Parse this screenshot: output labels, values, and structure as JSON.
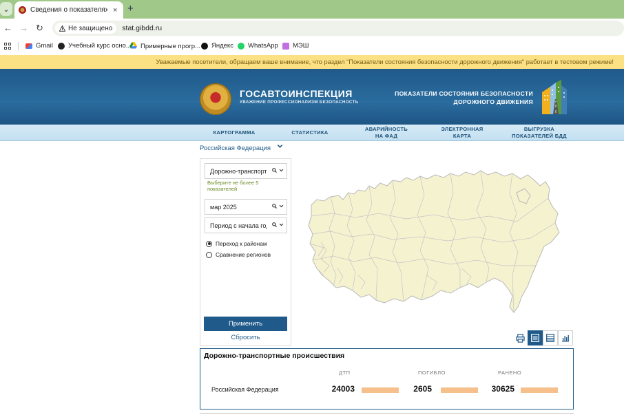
{
  "browser": {
    "tab_title": "Сведения о показателях состояния безопасности дорожного движения",
    "tab_close": "×",
    "new_tab": "+",
    "security_label": "Не защищено",
    "url": "stat.gibdd.ru",
    "nav": {
      "back": "←",
      "forward": "→",
      "reload": "↻"
    },
    "bookmarks": [
      {
        "label": "Gmail",
        "icon": "gmail-icon",
        "color": "#d93025"
      },
      {
        "label": "Учебный курс осно...",
        "icon": "globe-icon",
        "color": "#222222"
      },
      {
        "label": "Примерные прогр...",
        "icon": "google-drive-icon",
        "color": "#1e8e3e"
      },
      {
        "label": "Яндекс",
        "icon": "yandex-icon",
        "color": "#111111"
      },
      {
        "label": "WhatsApp",
        "icon": "whatsapp-icon",
        "color": "#25d366"
      },
      {
        "label": "МЭШ",
        "icon": "mesh-icon",
        "color": "#a040c0"
      }
    ]
  },
  "notice": "Уважаемые посетители, обращаем ваше внимание, что раздел \"Показатели состояния безопасности дорожного движения\" работает в тестовом режиме!",
  "header": {
    "brand_title": "ГОСАВТОИНСПЕКЦИЯ",
    "brand_subtitle": "УВАЖЕНИЕ ПРОФЕССИОНАЛИЗМ БЕЗОПАСНОСТЬ",
    "portal_title_line1": "ПОКАЗАТЕЛИ СОСТОЯНИЯ БЕЗОПАСНОСТИ",
    "portal_title_line2": "ДОРОЖНОГО ДВИЖЕНИЯ"
  },
  "menu": [
    {
      "line1": "КАРТОГРАММА",
      "line2": ""
    },
    {
      "line1": "СТАТИСТИКА",
      "line2": ""
    },
    {
      "line1": "АВАРИЙНОСТЬ",
      "line2": "НА ФАД"
    },
    {
      "line1": "ЭЛЕКТРОННАЯ",
      "line2": "КАРТА"
    },
    {
      "line1": "ВЫГРУЗКА",
      "line2": "ПОКАЗАТЕЛЕЙ БДД"
    }
  ],
  "filters": {
    "region": "Российская Федерация",
    "indicator": "Дорожно-транспортные происшествия",
    "indicator_hint": "Выберите не более 5 показателей",
    "period_month": "мар 2025",
    "period_type": "Период с начала года",
    "radio_districts": "Переход к районам",
    "radio_compare": "Сравнение регионов",
    "radio_selected": "districts",
    "apply_label": "Применить",
    "reset_label": "Сбросить"
  },
  "view_modes": [
    "print-icon",
    "list-view-icon",
    "table-view-icon",
    "chart-view-icon"
  ],
  "results": {
    "title": "Дорожно-транспортные происшествия",
    "columns": [
      "ДТП",
      "ПОГИБЛО",
      "РАНЕНО"
    ],
    "rows": [
      {
        "region": "Российская Федерация",
        "dtp": "24003",
        "killed": "2605",
        "injured": "30625"
      }
    ],
    "bar_color": "#f6c08d"
  },
  "colors": {
    "primary": "#1f5a8a",
    "notice_bg": "#fbe184",
    "map_fill": "#f5f2d0"
  }
}
